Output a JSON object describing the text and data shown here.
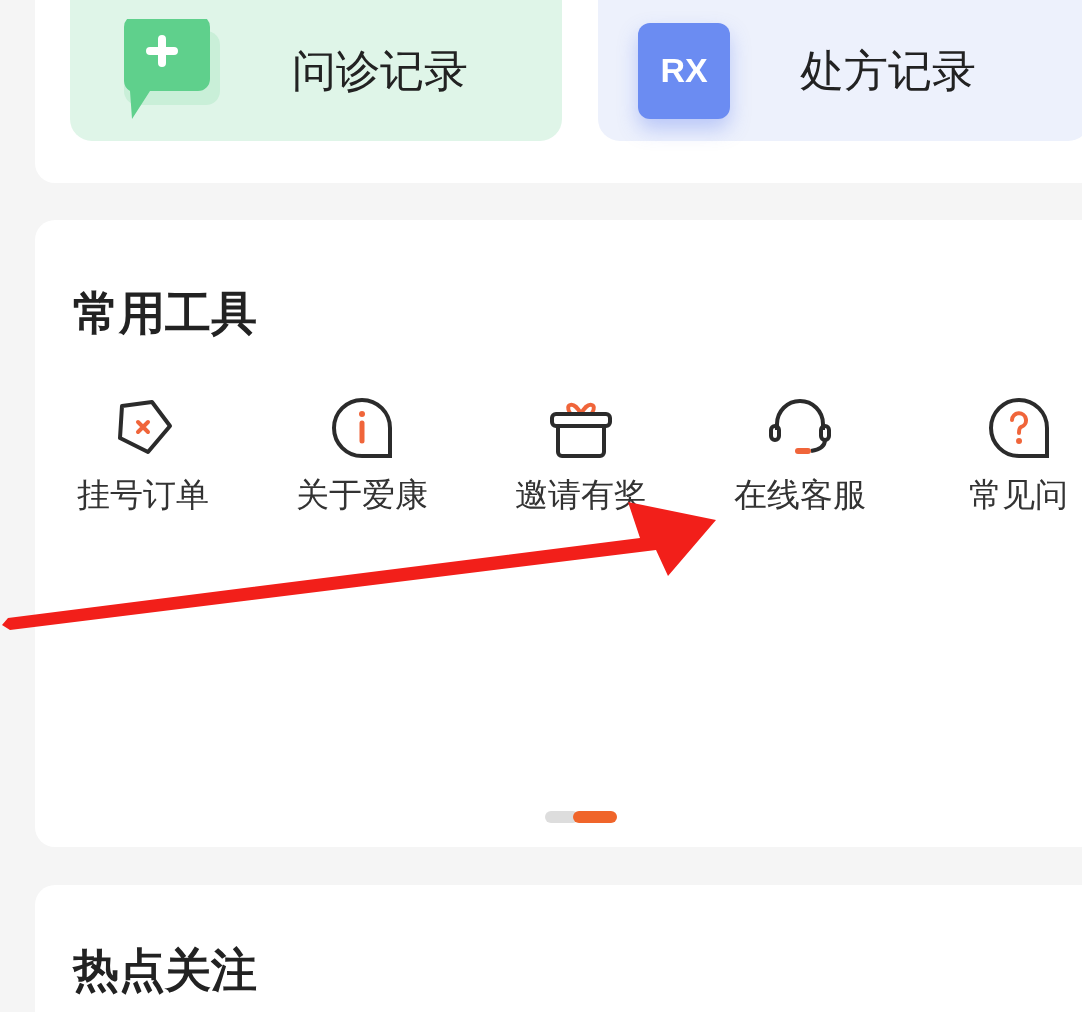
{
  "records": [
    {
      "kind": "consult",
      "label": "问诊记录"
    },
    {
      "kind": "prescription",
      "label": "处方记录",
      "icon_text": "RX"
    }
  ],
  "tools": {
    "title": "常用工具",
    "items": [
      {
        "kind": "tag",
        "label": "挂号订单"
      },
      {
        "kind": "info",
        "label": "关于爱康"
      },
      {
        "kind": "gift",
        "label": "邀请有奖"
      },
      {
        "kind": "headset",
        "label": "在线客服"
      },
      {
        "kind": "question",
        "label": "常见问"
      }
    ],
    "pages": [
      {
        "selected": false
      },
      {
        "selected": true
      }
    ]
  },
  "hot": {
    "title": "热点关注"
  }
}
